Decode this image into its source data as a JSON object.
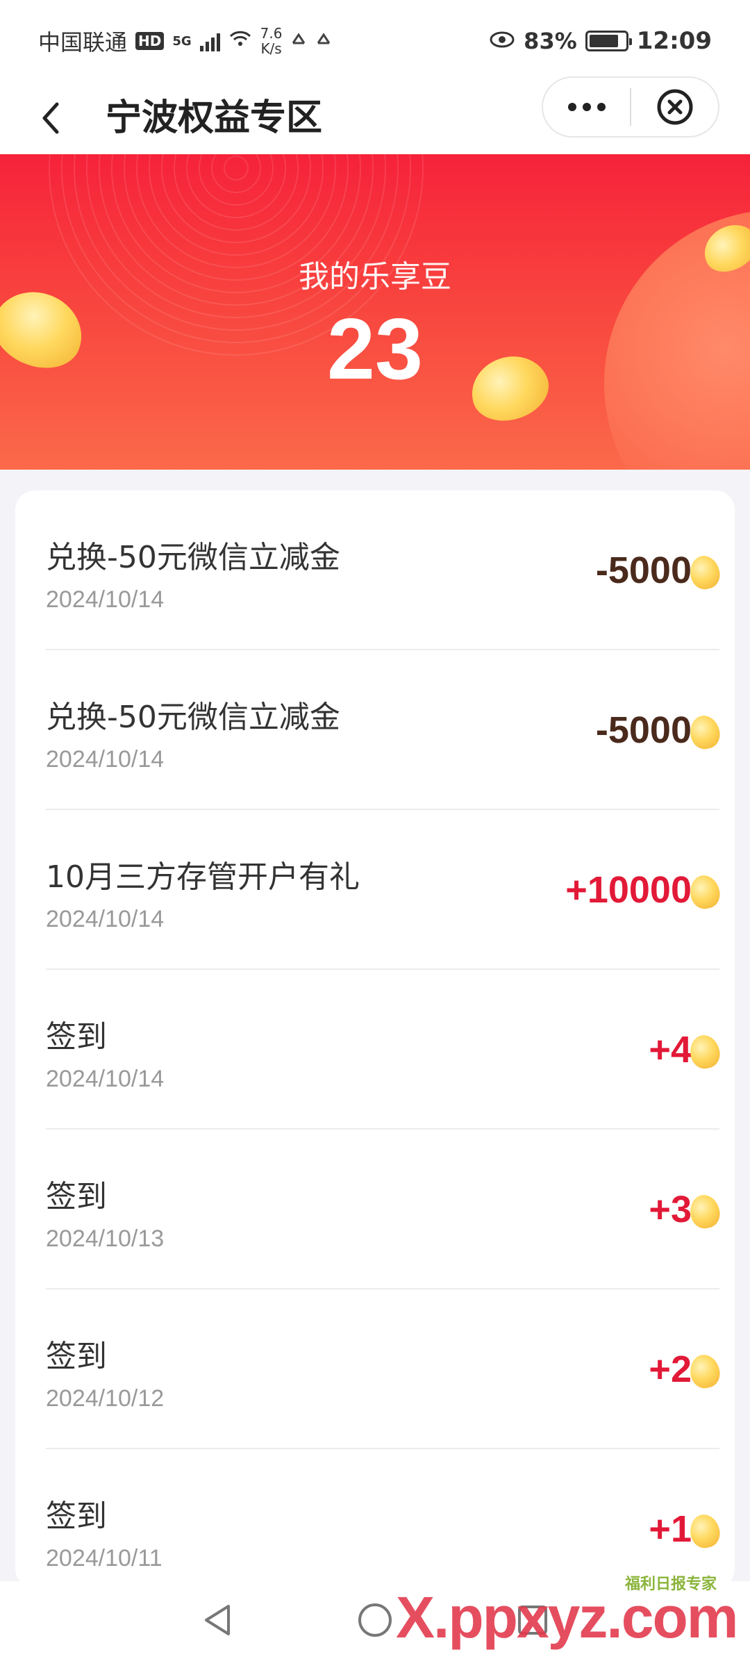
{
  "status_bar": {
    "carrier": "中国联通",
    "hd": "HD",
    "network": "5G",
    "speed_value": "7.6",
    "speed_unit": "K/s",
    "battery_percent": "83%",
    "time": "12:09"
  },
  "nav": {
    "title": "宁波权益专区"
  },
  "banner": {
    "label": "我的乐享豆",
    "value": "23"
  },
  "records": [
    {
      "title": "兑换-50元微信立减金",
      "date": "2024/10/14",
      "amount": "-5000",
      "sign": "neg"
    },
    {
      "title": "兑换-50元微信立减金",
      "date": "2024/10/14",
      "amount": "-5000",
      "sign": "neg"
    },
    {
      "title": "10月三方存管开户有礼",
      "date": "2024/10/14",
      "amount": "+10000",
      "sign": "pos"
    },
    {
      "title": "签到",
      "date": "2024/10/14",
      "amount": "+4",
      "sign": "pos"
    },
    {
      "title": "签到",
      "date": "2024/10/13",
      "amount": "+3",
      "sign": "pos"
    },
    {
      "title": "签到",
      "date": "2024/10/12",
      "amount": "+2",
      "sign": "pos"
    },
    {
      "title": "签到",
      "date": "2024/10/11",
      "amount": "+1",
      "sign": "pos"
    }
  ],
  "watermark": {
    "text": "X.ppxyz.com",
    "sub": "福利日报专家"
  },
  "colors": {
    "banner_red": "#f6223a",
    "positive": "#e21937",
    "negative": "#4a2a1c",
    "coin": "#ffd85e"
  },
  "icons": [
    "back-arrow-icon",
    "more-dots-icon",
    "close-circle-icon",
    "bean-coin-icon",
    "nav-back-icon",
    "nav-home-icon",
    "nav-recents-icon"
  ]
}
